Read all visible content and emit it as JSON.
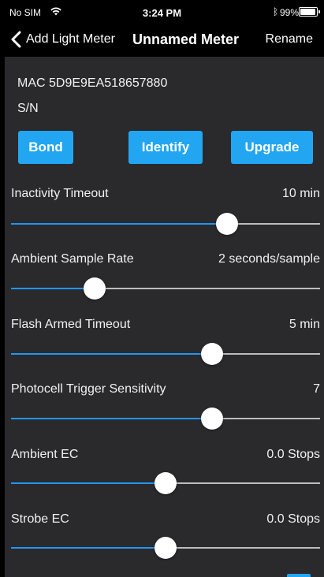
{
  "status_bar": {
    "carrier": "No SIM",
    "time": "3:24 PM",
    "battery_percent": "99%",
    "battery_level": 0.99
  },
  "nav": {
    "back_label": "Add Light Meter",
    "title": "Unnamed Meter",
    "right_action": "Rename"
  },
  "device": {
    "mac": "MAC 5D9E9EA518657880",
    "serial": "S/N"
  },
  "buttons": {
    "bond": "Bond",
    "identify": "Identify",
    "upgrade": "Upgrade"
  },
  "settings": [
    {
      "label": "Inactivity Timeout",
      "value": "10 min",
      "position": 0.7
    },
    {
      "label": "Ambient Sample Rate",
      "value": "2 seconds/sample",
      "position": 0.27
    },
    {
      "label": "Flash Armed Timeout",
      "value": "5 min",
      "position": 0.65
    },
    {
      "label": "Photocell Trigger Sensitivity",
      "value": "7",
      "position": 0.65
    },
    {
      "label": "Ambient EC",
      "value": "0.0 Stops",
      "position": 0.5
    },
    {
      "label": "Strobe EC",
      "value": "0.0 Stops",
      "position": 0.5
    }
  ],
  "colors": {
    "accent": "#22a6f2",
    "slider_fill": "#2196f3",
    "panel": "#2a2a2d",
    "background": "#000000"
  },
  "icons": {
    "wifi": "wifi-icon",
    "bluetooth": "bluetooth-icon",
    "battery": "battery-icon",
    "back": "chevron-left-icon"
  }
}
